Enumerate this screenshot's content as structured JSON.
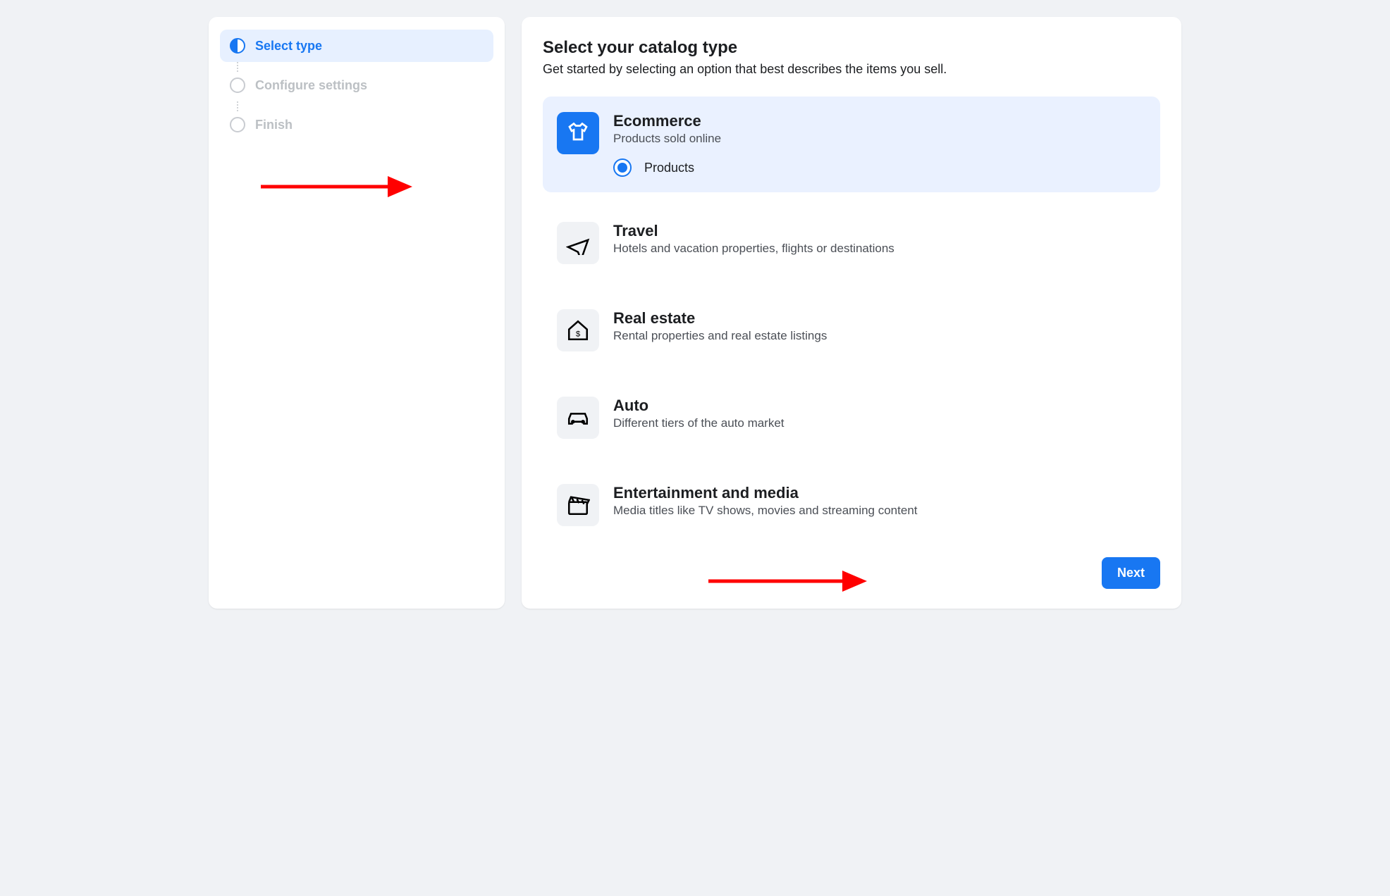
{
  "sidebar": {
    "steps": [
      {
        "label": "Select type",
        "active": true
      },
      {
        "label": "Configure settings",
        "active": false
      },
      {
        "label": "Finish",
        "active": false
      }
    ]
  },
  "main": {
    "title": "Select your catalog type",
    "subtitle": "Get started by selecting an option that best describes the items you sell.",
    "options": [
      {
        "title": "Ecommerce",
        "desc": "Products sold online",
        "selected": true,
        "radio_label": "Products",
        "icon": "tshirt-icon"
      },
      {
        "title": "Travel",
        "desc": "Hotels and vacation properties, flights or destinations",
        "selected": false,
        "icon": "plane-icon"
      },
      {
        "title": "Real estate",
        "desc": "Rental properties and real estate listings",
        "selected": false,
        "icon": "house-dollar-icon"
      },
      {
        "title": "Auto",
        "desc": "Different tiers of the auto market",
        "selected": false,
        "icon": "car-icon"
      },
      {
        "title": "Entertainment and media",
        "desc": "Media titles like TV shows, movies and streaming content",
        "selected": false,
        "icon": "clapperboard-icon"
      }
    ],
    "next_label": "Next"
  }
}
